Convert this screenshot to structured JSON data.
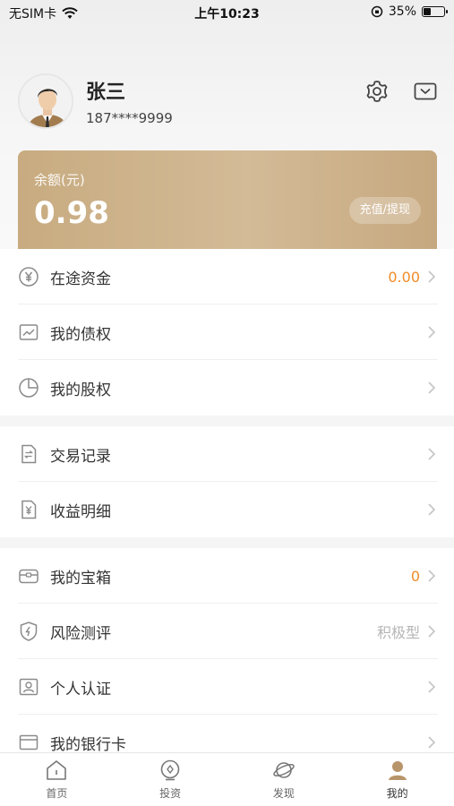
{
  "status_bar": {
    "carrier": "无SIM卡",
    "time": "上午10:23",
    "battery_percent": "35%",
    "battery_level": 0.35
  },
  "profile": {
    "name": "张三",
    "phone": "187****9999"
  },
  "balance": {
    "label": "余额(元)",
    "value": "0.98",
    "action_label": "充值/提现"
  },
  "menu_groups": [
    [
      {
        "label": "在途资金",
        "value": "0.00",
        "value_style": "orange",
        "icon": "yuan-circle-icon"
      },
      {
        "label": "我的债权",
        "value": "",
        "icon": "trend-chart-icon"
      },
      {
        "label": "我的股权",
        "value": "",
        "icon": "pie-chart-icon"
      }
    ],
    [
      {
        "label": "交易记录",
        "value": "",
        "icon": "transfer-document-icon"
      },
      {
        "label": "收益明细",
        "value": "",
        "icon": "yuan-document-icon"
      }
    ],
    [
      {
        "label": "我的宝箱",
        "value": "0",
        "value_style": "orange",
        "icon": "treasure-box-icon"
      },
      {
        "label": "风险测评",
        "value": "积极型",
        "value_style": "gray",
        "icon": "shield-bolt-icon"
      },
      {
        "label": "个人认证",
        "value": "",
        "icon": "id-card-icon"
      },
      {
        "label": "我的银行卡",
        "value": "",
        "icon": "bank-card-icon"
      }
    ]
  ],
  "tabs": [
    {
      "label": "首页",
      "icon": "home-icon"
    },
    {
      "label": "投资",
      "icon": "invest-icon"
    },
    {
      "label": "发现",
      "icon": "planet-icon"
    },
    {
      "label": "我的",
      "icon": "user-icon",
      "active": true
    }
  ],
  "colors": {
    "accent_orange": "#f08c28",
    "card_gold": "#c8ab80",
    "icon_gray": "#8a8a8a"
  }
}
